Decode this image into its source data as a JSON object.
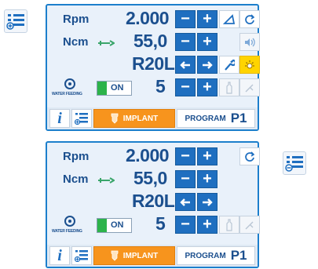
{
  "panels": [
    {
      "rpm_label": "Rpm",
      "rpm_value": "2.000",
      "ncm_label": "Ncm",
      "ncm_value": "55,0",
      "direction": "R20L",
      "water_label": "WATER FEEDING",
      "water_state": "ON",
      "water_level": "5",
      "implant_label": "IMPLANT",
      "program_label": "PROGRAM",
      "program_value": "P1"
    },
    {
      "rpm_label": "Rpm",
      "rpm_value": "2.000",
      "ncm_label": "Ncm",
      "ncm_value": "55,0",
      "direction": "R20L",
      "water_label": "WATER FEEDING",
      "water_state": "ON",
      "water_level": "5",
      "implant_label": "IMPLANT",
      "program_label": "PROGRAM",
      "program_value": "P1"
    }
  ],
  "buttons": {
    "minus": "−",
    "plus": "+",
    "info": "i"
  },
  "colors": {
    "panel_border": "#1c7fcc",
    "button_blue": "#1f6fc0",
    "implant_orange": "#f7941d",
    "accent_gold": "#ffd400",
    "label_blue": "#1b4f8e",
    "on_green": "#2db34a"
  },
  "icons": [
    "list-expand-icon",
    "list-collapse-icon",
    "angle-icon",
    "refresh-icon",
    "sound-icon",
    "wrench-icon",
    "light-icon",
    "bottle-icon",
    "handpiece-icon",
    "torque-wrench-icon",
    "water-feeding-icon",
    "info-icon",
    "list-icon",
    "implant-icon"
  ]
}
